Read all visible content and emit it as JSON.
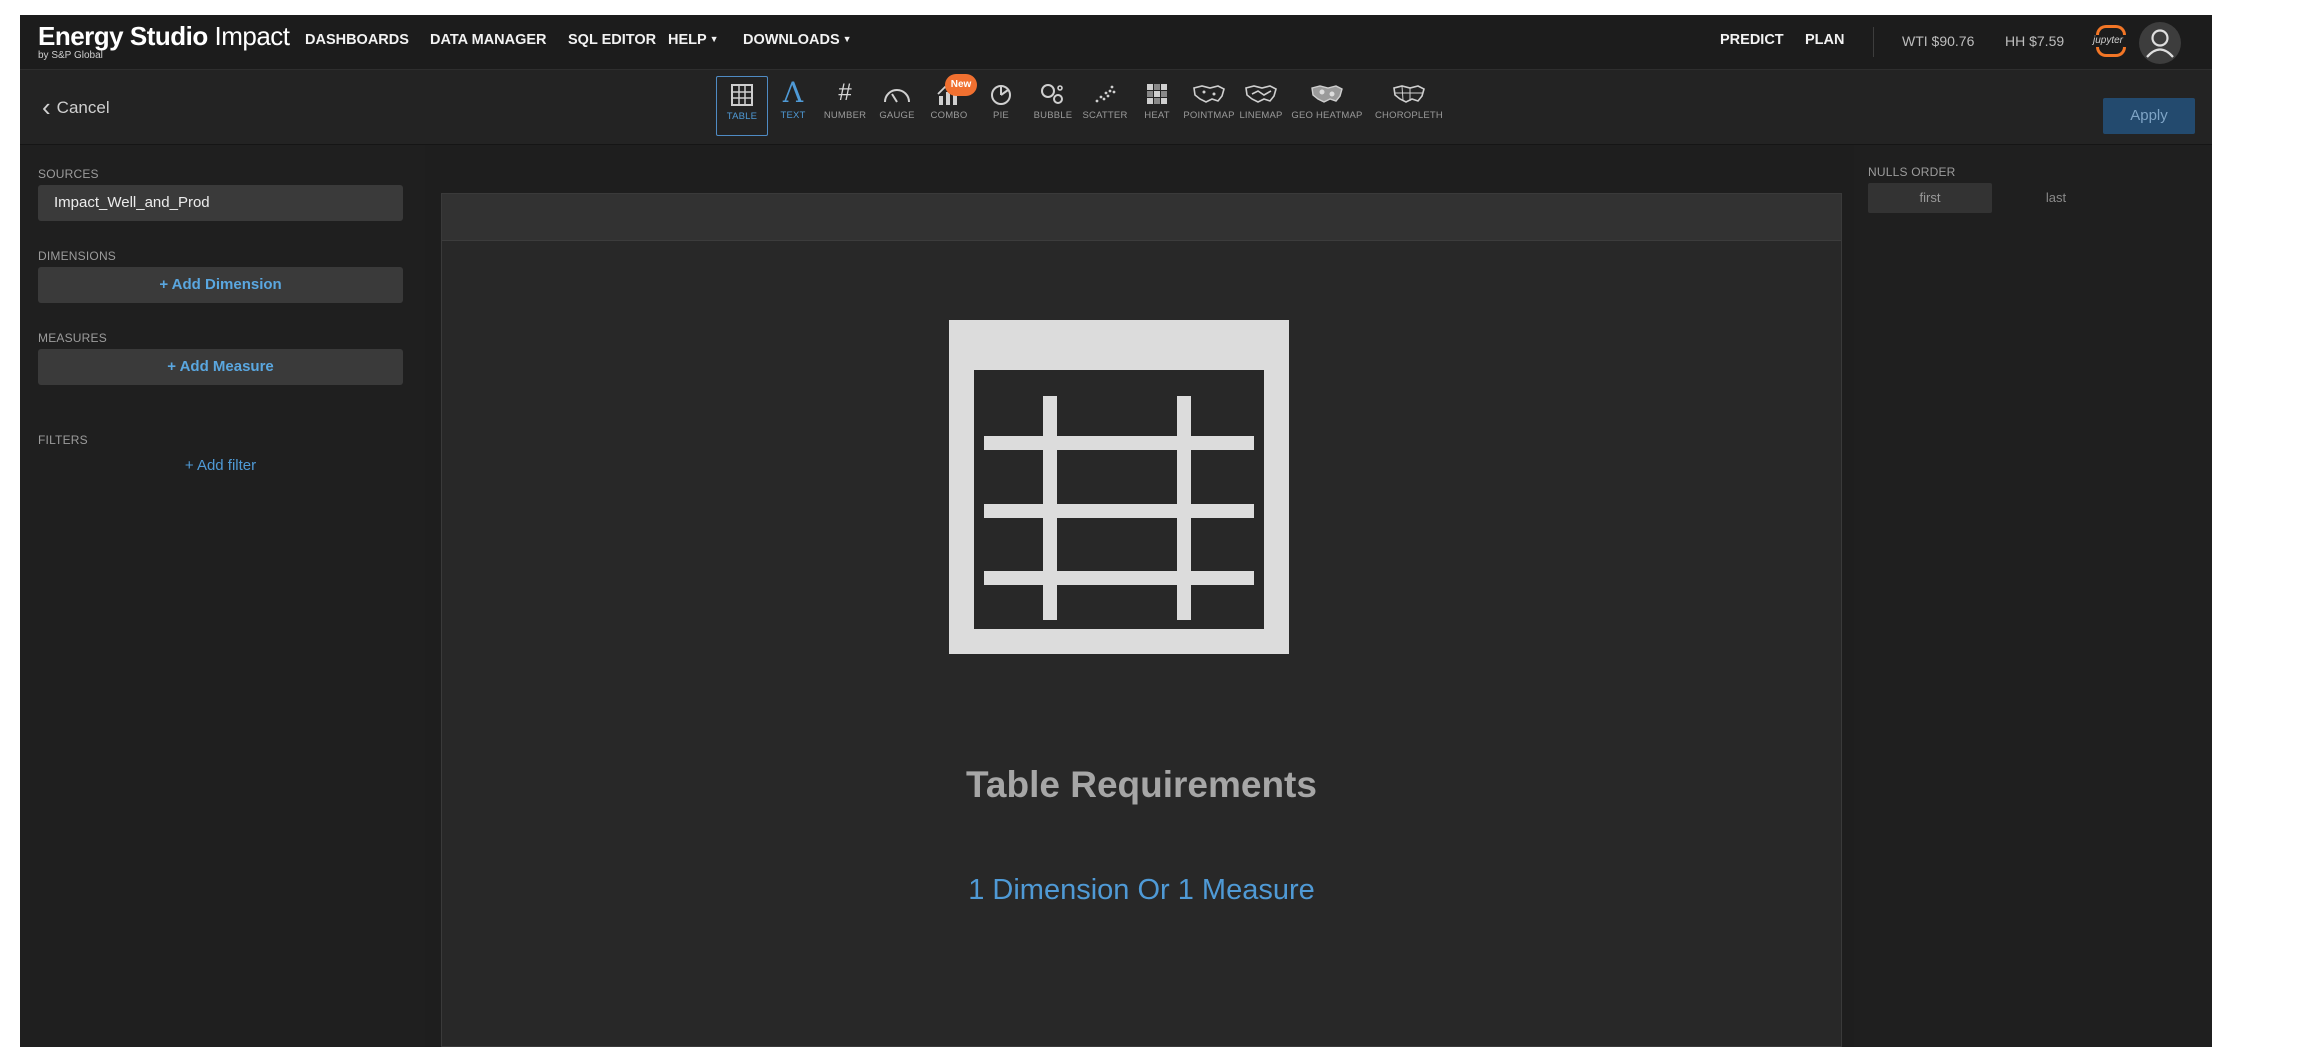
{
  "brand": {
    "name_bold": "Energy Studio",
    "name_light": " Impact",
    "byline": "by S&P Global"
  },
  "nav": {
    "dashboards": "DASHBOARDS",
    "data_manager": "DATA MANAGER",
    "sql_editor": "SQL EDITOR",
    "help": "HELP",
    "downloads": "DOWNLOADS",
    "predict": "PREDICT",
    "plan": "PLAN"
  },
  "prices": {
    "wti": "WTI $90.76",
    "hh": "HH $7.59"
  },
  "jupyter_label": "jupyter",
  "toolbar": {
    "cancel_label": "Cancel",
    "apply_label": "Apply",
    "new_badge": "New",
    "chart_types": [
      {
        "label": "TABLE",
        "icon": "table-icon"
      },
      {
        "label": "TEXT",
        "icon": "text-icon"
      },
      {
        "label": "NUMBER",
        "icon": "hash-icon"
      },
      {
        "label": "GAUGE",
        "icon": "gauge-icon"
      },
      {
        "label": "COMBO",
        "icon": "combo-icon"
      },
      {
        "label": "PIE",
        "icon": "pie-icon"
      },
      {
        "label": "BUBBLE",
        "icon": "bubble-icon"
      },
      {
        "label": "SCATTER",
        "icon": "scatter-icon"
      },
      {
        "label": "HEAT",
        "icon": "heat-icon"
      },
      {
        "label": "POINTMAP",
        "icon": "pointmap-icon"
      },
      {
        "label": "LINEMAP",
        "icon": "linemap-icon"
      },
      {
        "label": "GEO HEATMAP",
        "icon": "geo-heatmap-icon"
      },
      {
        "label": "CHOROPLETH",
        "icon": "choropleth-icon"
      }
    ]
  },
  "left_panel": {
    "sources_label": "SOURCES",
    "source_value": "Impact_Well_and_Prod",
    "dimensions_label": "DIMENSIONS",
    "add_dimension": "+ Add Dimension",
    "measures_label": "MEASURES",
    "add_measure": "+ Add Measure",
    "filters_label": "FILTERS",
    "add_filter": "+ Add filter"
  },
  "canvas": {
    "title": "Table Requirements",
    "subtitle": "1 Dimension Or 1 Measure"
  },
  "right_panel": {
    "nulls_order_label": "NULLS ORDER",
    "first": "first",
    "last": "last"
  },
  "colors": {
    "accent_blue": "#4f9ad6",
    "badge_orange": "#f07030",
    "background": "#232323"
  }
}
